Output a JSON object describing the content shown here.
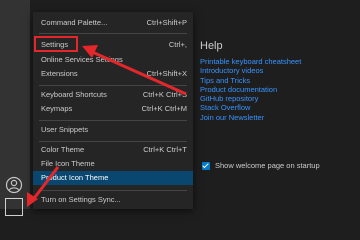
{
  "welcome": {
    "help_title": "Help",
    "links": [
      "Printable keyboard cheatsheet",
      "Introductory videos",
      "Tips and Tricks",
      "Product documentation",
      "GitHub repository",
      "Stack Overflow",
      "Join our Newsletter"
    ],
    "startup_checkbox_label": "Show welcome page on startup",
    "startup_checked": true
  },
  "menu": {
    "items": [
      {
        "label": "Command Palette...",
        "shortcut": "Ctrl+Shift+P"
      },
      {
        "label": "Settings",
        "shortcut": "Ctrl+,"
      },
      {
        "label": "Online Services Settings",
        "shortcut": ""
      },
      {
        "label": "Extensions",
        "shortcut": "Ctrl+Shift+X"
      },
      {
        "label": "Keyboard Shortcuts",
        "shortcut": "Ctrl+K Ctrl+S"
      },
      {
        "label": "Keymaps",
        "shortcut": "Ctrl+K Ctrl+M"
      },
      {
        "label": "User Snippets",
        "shortcut": ""
      },
      {
        "label": "Color Theme",
        "shortcut": "Ctrl+K Ctrl+T"
      },
      {
        "label": "File Icon Theme",
        "shortcut": ""
      },
      {
        "label": "Product Icon Theme",
        "shortcut": ""
      },
      {
        "label": "Turn on Settings Sync...",
        "shortcut": ""
      }
    ]
  },
  "icons": {
    "account": "account-icon",
    "manage": "gear-icon"
  },
  "colors": {
    "link": "#3794ff",
    "selected_item_bg": "#094771",
    "annotation_red": "#e3272b"
  }
}
